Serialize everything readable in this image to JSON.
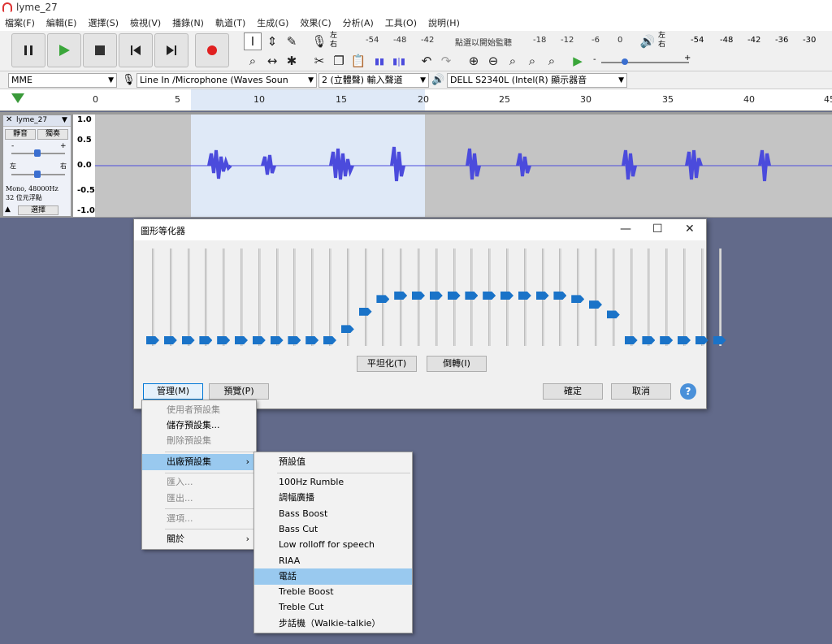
{
  "window": {
    "title": "lyme_27"
  },
  "menubar": [
    "檔案(F)",
    "編輯(E)",
    "選擇(S)",
    "檢視(V)",
    "播錄(N)",
    "軌道(T)",
    "生成(G)",
    "效果(C)",
    "分析(A)",
    "工具(O)",
    "說明(H)"
  ],
  "transport": [
    "pause",
    "play",
    "stop",
    "skip-start",
    "skip-end",
    "record"
  ],
  "meter": {
    "rec_label": "左\n右",
    "rec_prompt": "點選以開始監聽",
    "rec_ticks": [
      "-54",
      "-48",
      "-42",
      "-18",
      "-12",
      "-6",
      "0"
    ],
    "play_label": "左\n右",
    "play_ticks": [
      "-54",
      "-48",
      "-42",
      "-36",
      "-30"
    ],
    "slider_min": "-",
    "slider_max": "+"
  },
  "devices": {
    "host": "MME",
    "input": "Line In /Microphone (Waves Soun",
    "channels": "2 (立體聲) 輸入聲道",
    "output": "DELL S2340L (Intel(R) 顯示器音"
  },
  "ruler": [
    "0",
    "5",
    "10",
    "15",
    "20",
    "25",
    "30",
    "35",
    "40",
    "45"
  ],
  "track": {
    "name": "lyme_27",
    "mute": "靜音",
    "solo": "獨奏",
    "gain_min": "-",
    "gain_max": "+",
    "pan_left": "左",
    "pan_right": "右",
    "info1": "Mono, 48000Hz",
    "info2": "32 位元浮點",
    "select": "選擇",
    "scale": [
      "1.0",
      "0.5",
      "0.0",
      "-0.5",
      "-1.0"
    ]
  },
  "dialog": {
    "title": "圖形等化器",
    "eq_levels": [
      0,
      0,
      0,
      0,
      0,
      0,
      0,
      0,
      0,
      0,
      0,
      0.22,
      0.57,
      0.82,
      0.89,
      0.89,
      0.89,
      0.89,
      0.89,
      0.89,
      0.89,
      0.89,
      0.89,
      0.89,
      0.82,
      0.71,
      0.51,
      0,
      0,
      0,
      0,
      0,
      0
    ],
    "flatten": "平坦化(T)",
    "invert": "倒轉(I)",
    "manage": "管理(M)",
    "preview": "預覽(P)",
    "ok": "確定",
    "cancel": "取消",
    "help": "?"
  },
  "manage_menu": [
    "使用者預設集",
    "儲存預設集...",
    "刪除預設集",
    "出廠預設集",
    "匯入...",
    "匯出...",
    "選項...",
    "關於"
  ],
  "factory_menu": [
    "預設值",
    "100Hz Rumble",
    "調幅廣播",
    "Bass Boost",
    "Bass Cut",
    "Low rolloff for speech",
    "RIAA",
    "電話",
    "Treble Boost",
    "Treble Cut",
    "步話機（Walkie-talkie）"
  ],
  "colors": {
    "accent": "#1a73c8",
    "selection": "#99c9ef",
    "wave": "#4b4bdc"
  }
}
